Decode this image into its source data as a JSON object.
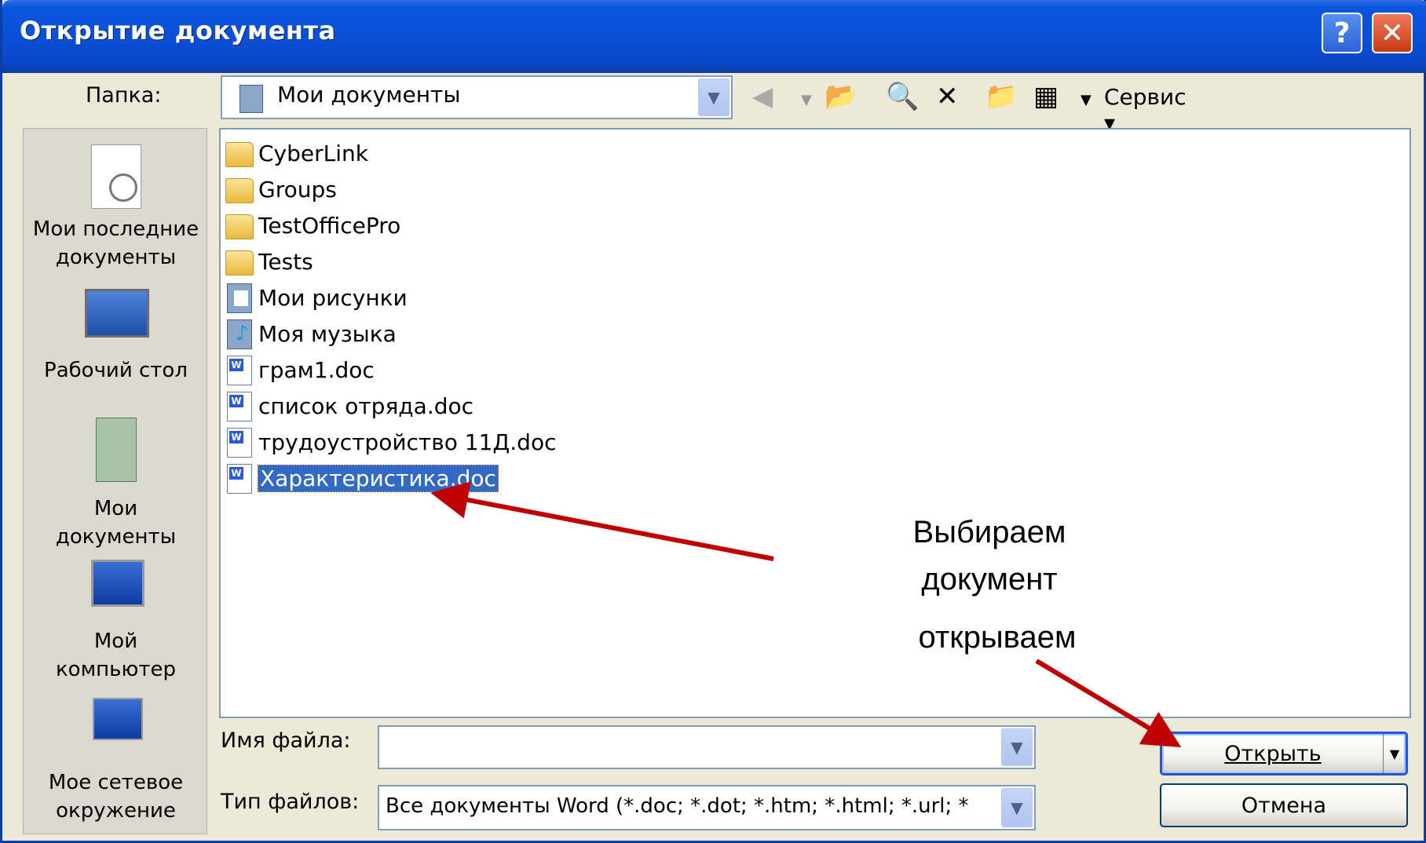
{
  "window": {
    "title": "Открытие документа"
  },
  "folder_bar": {
    "label": "Папка:",
    "current": "Мои документы",
    "service": "Сервис"
  },
  "places": [
    {
      "line1": "Мои последние",
      "line2": "документы",
      "icon": "recent-documents-icon"
    },
    {
      "line1": "Рабочий стол",
      "line2": "",
      "icon": "desktop-icon"
    },
    {
      "line1": "Мои",
      "line2": "документы",
      "icon": "my-documents-icon"
    },
    {
      "line1": "Мой",
      "line2": "компьютер",
      "icon": "my-computer-icon"
    },
    {
      "line1": "Мое сетевое",
      "line2": "окружение",
      "icon": "network-places-icon"
    }
  ],
  "files": [
    {
      "name": "CyberLink",
      "type": "folder"
    },
    {
      "name": "Groups",
      "type": "folder"
    },
    {
      "name": "TestOfficePro",
      "type": "folder"
    },
    {
      "name": "Tests",
      "type": "folder"
    },
    {
      "name": "Мои рисунки",
      "type": "pictures"
    },
    {
      "name": "Моя музыка",
      "type": "music"
    },
    {
      "name": "грам1.doc",
      "type": "doc"
    },
    {
      "name": "список отряда.doc",
      "type": "doc"
    },
    {
      "name": "трудоустройство 11Д.doc",
      "type": "doc"
    },
    {
      "name": "Характеристика.doc",
      "type": "doc",
      "selected": true
    }
  ],
  "filename": {
    "label": "Имя файла:",
    "value": ""
  },
  "filetype": {
    "label": "Тип файлов:",
    "value": "Все документы Word (*.doc; *.dot; *.htm; *.html; *.url; *"
  },
  "buttons": {
    "open": "Открыть",
    "cancel": "Отмена"
  },
  "annotations": {
    "line1": "Выбираем",
    "line2": "документ",
    "line3": "открываем"
  },
  "colors": {
    "selection": "#316ac5",
    "arrow": "#c00000",
    "titlebar": "#0a4fd6"
  }
}
